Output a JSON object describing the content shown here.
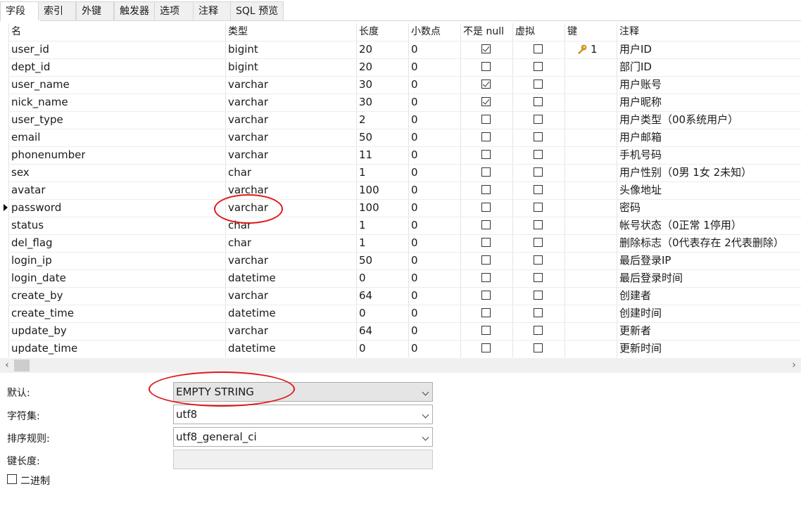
{
  "tabs": [
    "字段",
    "索引",
    "外键",
    "触发器",
    "选项",
    "注释",
    "SQL 预览"
  ],
  "columns": [
    "名",
    "类型",
    "长度",
    "小数点",
    "不是 null",
    "虚拟",
    "键",
    "注释"
  ],
  "rows": [
    {
      "name": "user_id",
      "type": "bigint",
      "length": "20",
      "decimals": "0",
      "not_null": true,
      "virtual": false,
      "key": "1",
      "comment": "用户ID"
    },
    {
      "name": "dept_id",
      "type": "bigint",
      "length": "20",
      "decimals": "0",
      "not_null": false,
      "virtual": false,
      "key": "",
      "comment": "部门ID"
    },
    {
      "name": "user_name",
      "type": "varchar",
      "length": "30",
      "decimals": "0",
      "not_null": true,
      "virtual": false,
      "key": "",
      "comment": "用户账号"
    },
    {
      "name": "nick_name",
      "type": "varchar",
      "length": "30",
      "decimals": "0",
      "not_null": true,
      "virtual": false,
      "key": "",
      "comment": "用户昵称"
    },
    {
      "name": "user_type",
      "type": "varchar",
      "length": "2",
      "decimals": "0",
      "not_null": false,
      "virtual": false,
      "key": "",
      "comment": "用户类型（00系统用户）"
    },
    {
      "name": "email",
      "type": "varchar",
      "length": "50",
      "decimals": "0",
      "not_null": false,
      "virtual": false,
      "key": "",
      "comment": "用户邮箱"
    },
    {
      "name": "phonenumber",
      "type": "varchar",
      "length": "11",
      "decimals": "0",
      "not_null": false,
      "virtual": false,
      "key": "",
      "comment": "手机号码"
    },
    {
      "name": "sex",
      "type": "char",
      "length": "1",
      "decimals": "0",
      "not_null": false,
      "virtual": false,
      "key": "",
      "comment": "用户性别（0男 1女 2未知）"
    },
    {
      "name": "avatar",
      "type": "varchar",
      "length": "100",
      "decimals": "0",
      "not_null": false,
      "virtual": false,
      "key": "",
      "comment": "头像地址"
    },
    {
      "name": "password",
      "type": "varchar",
      "length": "100",
      "decimals": "0",
      "not_null": false,
      "virtual": false,
      "key": "",
      "comment": "密码"
    },
    {
      "name": "status",
      "type": "char",
      "length": "1",
      "decimals": "0",
      "not_null": false,
      "virtual": false,
      "key": "",
      "comment": "帐号状态（0正常 1停用）"
    },
    {
      "name": "del_flag",
      "type": "char",
      "length": "1",
      "decimals": "0",
      "not_null": false,
      "virtual": false,
      "key": "",
      "comment": "删除标志（0代表存在 2代表删除）"
    },
    {
      "name": "login_ip",
      "type": "varchar",
      "length": "50",
      "decimals": "0",
      "not_null": false,
      "virtual": false,
      "key": "",
      "comment": "最后登录IP"
    },
    {
      "name": "login_date",
      "type": "datetime",
      "length": "0",
      "decimals": "0",
      "not_null": false,
      "virtual": false,
      "key": "",
      "comment": "最后登录时间"
    },
    {
      "name": "create_by",
      "type": "varchar",
      "length": "64",
      "decimals": "0",
      "not_null": false,
      "virtual": false,
      "key": "",
      "comment": "创建者"
    },
    {
      "name": "create_time",
      "type": "datetime",
      "length": "0",
      "decimals": "0",
      "not_null": false,
      "virtual": false,
      "key": "",
      "comment": "创建时间"
    },
    {
      "name": "update_by",
      "type": "varchar",
      "length": "64",
      "decimals": "0",
      "not_null": false,
      "virtual": false,
      "key": "",
      "comment": "更新者"
    },
    {
      "name": "update_time",
      "type": "datetime",
      "length": "0",
      "decimals": "0",
      "not_null": false,
      "virtual": false,
      "key": "",
      "comment": "更新时间"
    }
  ],
  "selected_row": "password",
  "props": {
    "default_label": "默认:",
    "default_value": "EMPTY STRING",
    "charset_label": "字符集:",
    "charset_value": "utf8",
    "collation_label": "排序规则:",
    "collation_value": "utf8_general_ci",
    "keylength_label": "键长度:",
    "keylength_value": "",
    "binary_label": "二进制"
  },
  "colors": {
    "highlight_circle": "#e01818",
    "key_icon": "#e6a817"
  }
}
